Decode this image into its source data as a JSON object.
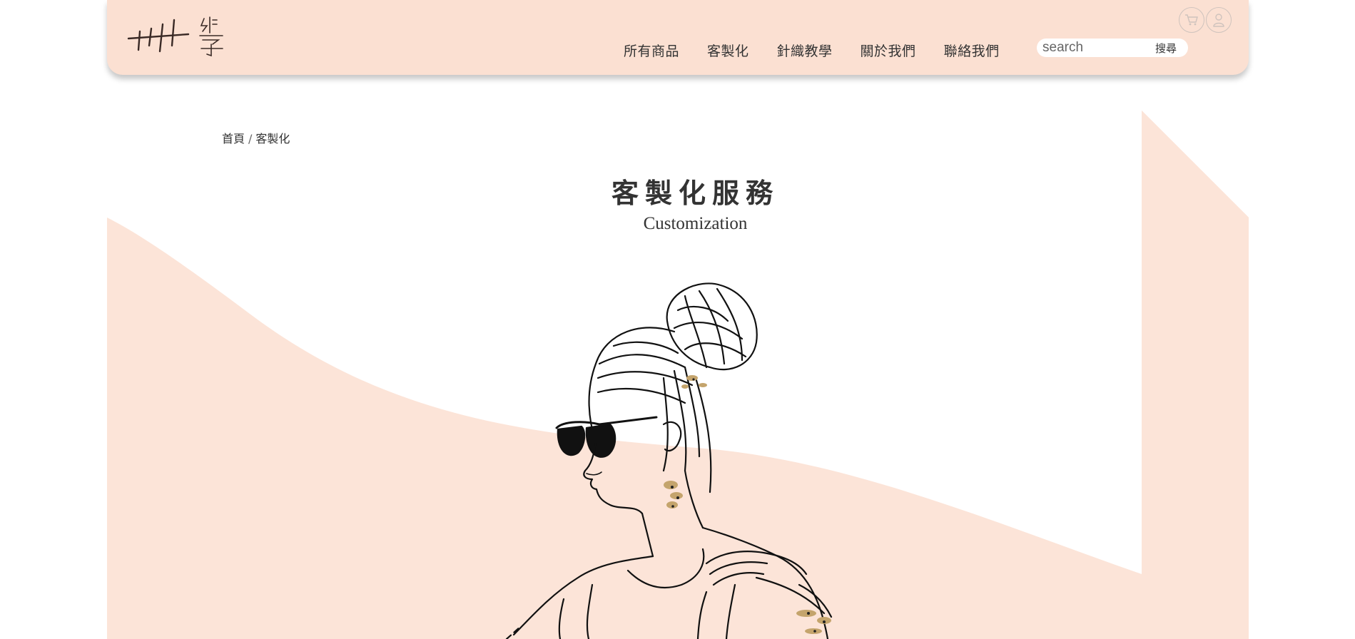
{
  "header": {
    "logo_text": "織學",
    "nav": [
      {
        "label": "所有商品"
      },
      {
        "label": "客製化"
      },
      {
        "label": "針織教學"
      },
      {
        "label": "關於我們"
      },
      {
        "label": "聯絡我們"
      }
    ],
    "search": {
      "placeholder": "search",
      "button_label": "搜尋"
    },
    "icons": [
      "cart-icon",
      "user-icon"
    ]
  },
  "breadcrumb": {
    "home": "首頁",
    "separator": "/",
    "current": "客製化"
  },
  "page": {
    "title": "客製化服務",
    "subtitle": "Customization"
  },
  "colors": {
    "header_bg": "#fbe0d2",
    "frame_bg": "#fce4d8",
    "accent_gold": "#c4a46c",
    "text": "#333333"
  }
}
